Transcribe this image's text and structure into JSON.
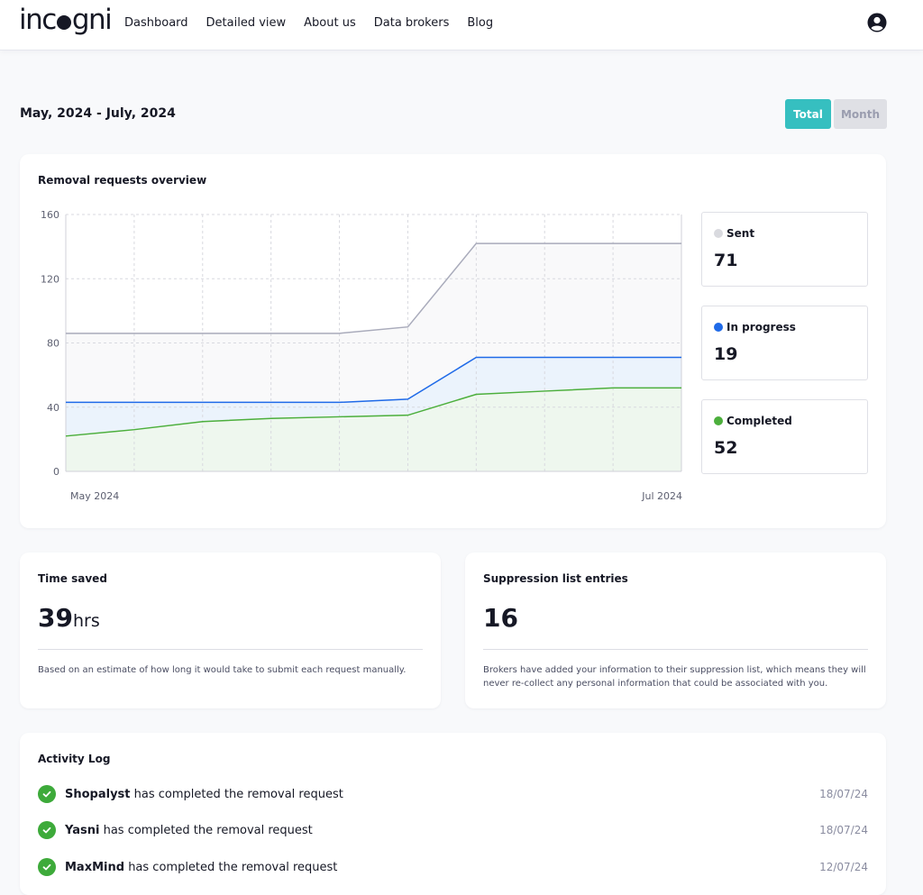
{
  "header": {
    "logo": "incogni",
    "nav": [
      "Dashboard",
      "Detailed view",
      "About us",
      "Data brokers",
      "Blog"
    ],
    "user_icon": "user-circle-icon"
  },
  "date_range": "May, 2024 - July, 2024",
  "toggle": {
    "total_label": "Total",
    "month_label": "Month",
    "selected": "Total"
  },
  "overview": {
    "title": "Removal requests overview",
    "stats": [
      {
        "label": "Sent",
        "value": "71",
        "color": "#d9dadf"
      },
      {
        "label": "In progress",
        "value": "19",
        "color": "#1f6ae8"
      },
      {
        "label": "Completed",
        "value": "52",
        "color": "#4caf3c"
      }
    ]
  },
  "chart_data": {
    "type": "area",
    "stacked": true,
    "title": "Removal requests overview",
    "xlabel": "",
    "ylabel": "",
    "x_tick_labels": [
      "May 2024",
      "Jul 2024"
    ],
    "x_points": 10,
    "ylim": [
      0,
      160
    ],
    "yticks": [
      0,
      40,
      80,
      120,
      160
    ],
    "grid": true,
    "series": [
      {
        "name": "Completed",
        "color": "#4caf3c",
        "fill": "#eef7ee",
        "values": [
          22,
          26,
          31,
          33,
          34,
          35,
          48,
          50,
          52,
          52
        ]
      },
      {
        "name": "In progress",
        "color": "#1f6ae8",
        "fill": "#ebf3fc",
        "values": [
          21,
          17,
          12,
          10,
          9,
          10,
          23,
          21,
          19,
          19
        ]
      },
      {
        "name": "Sent",
        "color": "#a9abbb",
        "fill": "#f9f9fa",
        "values": [
          43,
          43,
          43,
          43,
          43,
          45,
          71,
          71,
          71,
          71
        ]
      }
    ]
  },
  "time_saved": {
    "title": "Time saved",
    "value": "39",
    "unit": "hrs",
    "description": "Based on an estimate of how long it would take to submit each request manually."
  },
  "suppression": {
    "title": "Suppression list entries",
    "value": "16",
    "description": "Brokers have added your information to their suppression list, which means they will never re-collect any personal information that could be associated with you."
  },
  "activity": {
    "title": "Activity Log",
    "items": [
      {
        "broker": "Shopalyst",
        "text": " has completed the removal request",
        "date": "18/07/24"
      },
      {
        "broker": "Yasni",
        "text": " has completed the removal request",
        "date": "18/07/24"
      },
      {
        "broker": "MaxMind",
        "text": " has completed the removal request",
        "date": "12/07/24"
      }
    ]
  }
}
